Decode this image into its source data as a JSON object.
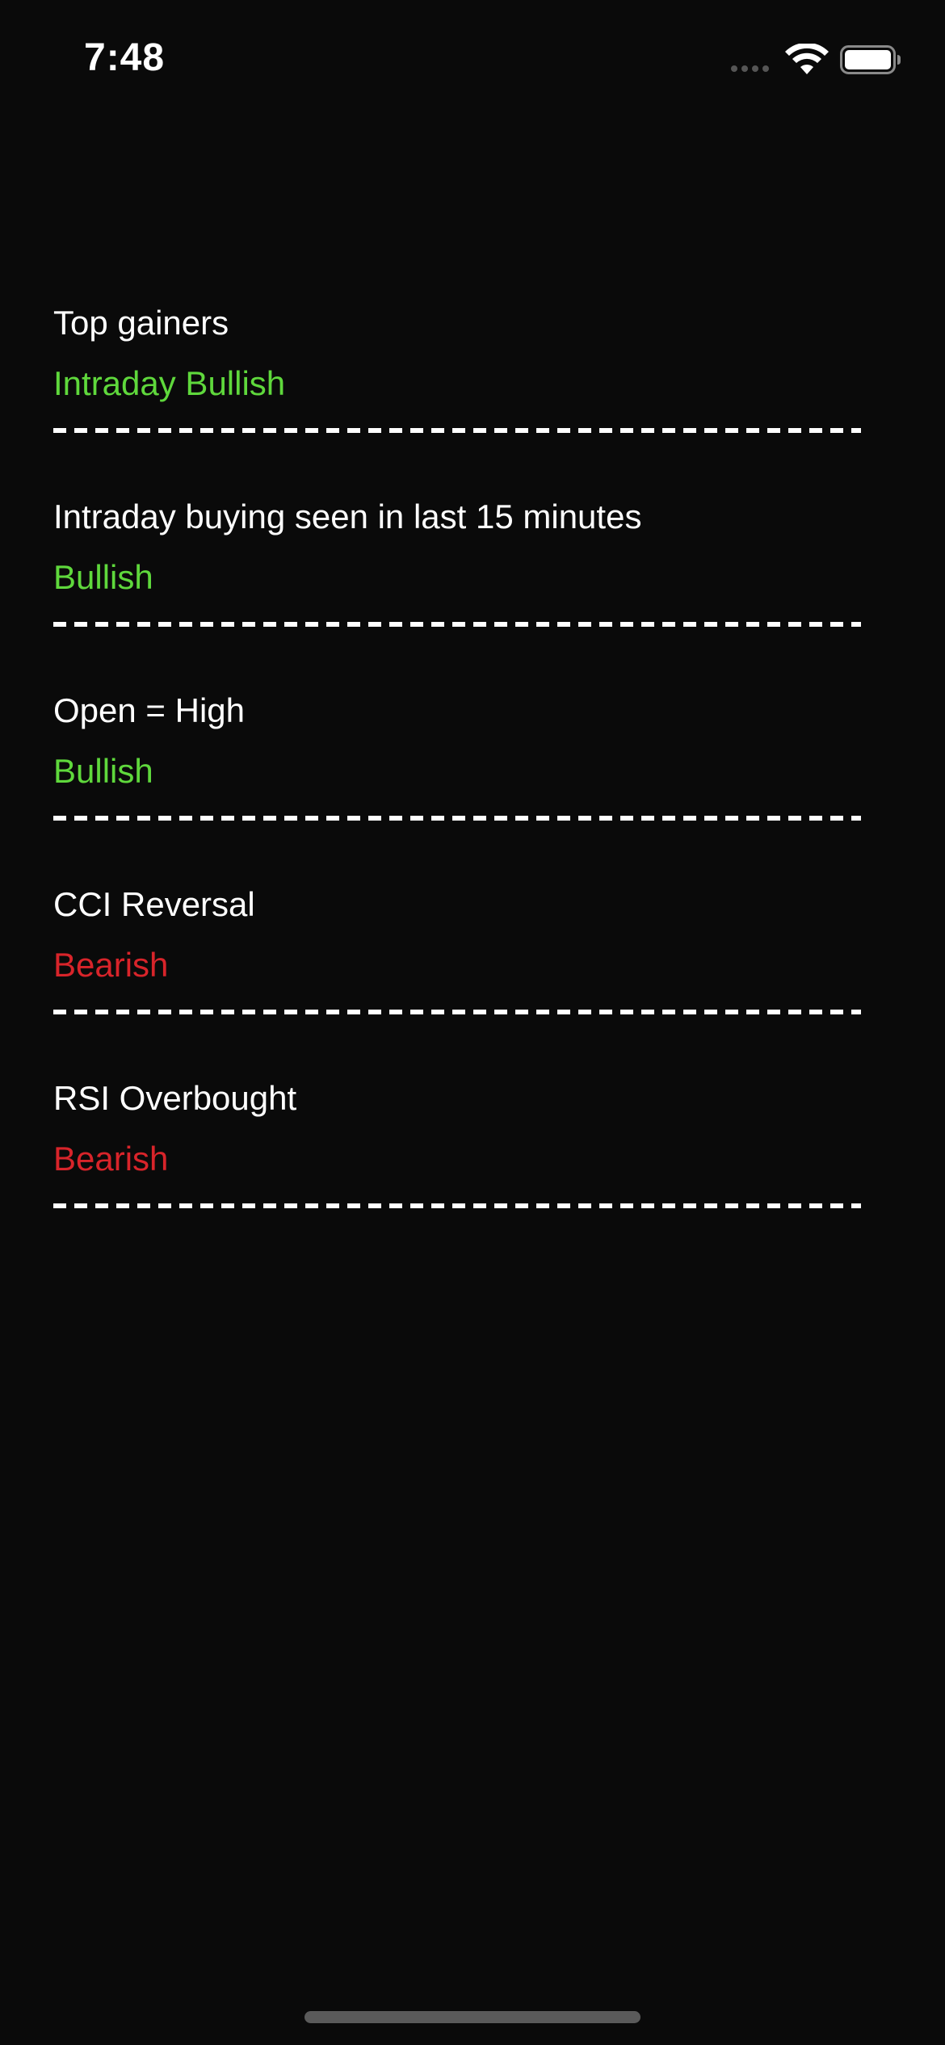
{
  "status_bar": {
    "time": "7:48",
    "icons": [
      "signal-dots-icon",
      "wifi-icon",
      "battery-icon"
    ]
  },
  "colors": {
    "background": "#0a0a0a",
    "bullish": "#5fd83c",
    "bearish": "#d8242a",
    "text": "#ffffff"
  },
  "signals": [
    {
      "title": "Top gainers",
      "sentiment": "Intraday Bullish",
      "type": "bullish"
    },
    {
      "title": "Intraday buying seen in last 15 minutes",
      "sentiment": "Bullish",
      "type": "bullish"
    },
    {
      "title": "Open = High",
      "sentiment": "Bullish",
      "type": "bullish"
    },
    {
      "title": "CCI Reversal",
      "sentiment": "Bearish",
      "type": "bearish"
    },
    {
      "title": "RSI Overbought",
      "sentiment": "Bearish",
      "type": "bearish"
    }
  ]
}
